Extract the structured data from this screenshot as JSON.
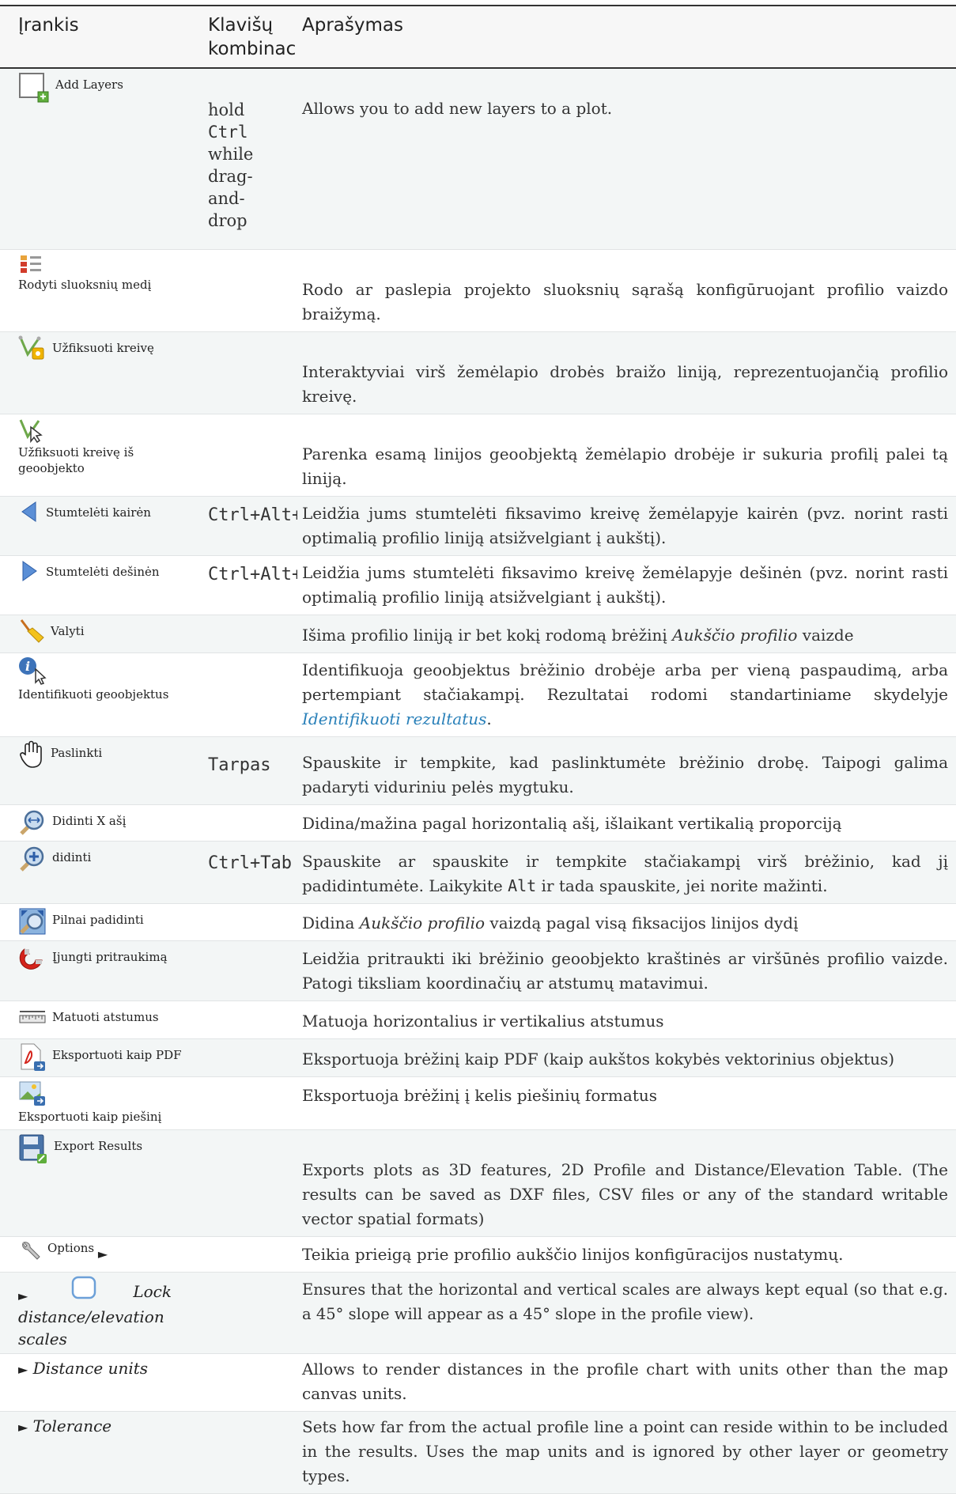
{
  "header": {
    "col_tool": "Įrankis",
    "col_keys": "Klavišų kombinacija",
    "col_desc": "Aprašymas"
  },
  "rows": [
    {
      "tool": "Add Layers",
      "icon": "add-layers-icon",
      "keys_hold": "hold",
      "keys_ctrl": "Ctrl",
      "keys_rest": "while drag-and-drop",
      "desc": "Allows you to add new layers to a plot."
    },
    {
      "tool": "Rodyti sluoksnių medį",
      "icon": "layer-tree-icon",
      "desc": "Rodo ar paslepia projekto sluoksnių sąrašą konfigūruojant profilio vaizdo braižymą."
    },
    {
      "tool": "Užfiksuoti kreivę",
      "icon": "capture-curve-icon",
      "desc": "Interaktyviai virš žemėlapio drobės braižo liniją, reprezentuojančią profilio kreivę."
    },
    {
      "tool": "Užfiksuoti kreivę iš geoobjekto",
      "icon": "capture-curve-from-feature-icon",
      "desc": "Parenka esamą linijos geoobjektą žemėlapio drobėje ir sukuria profilį palei tą liniją."
    },
    {
      "tool": "Stumtelėti kairėn",
      "icon": "nudge-left-icon",
      "keys": "Ctrl+Alt+Left",
      "desc": "Leidžia jums stumtelėti fiksavimo kreivę žemėlapyje kairėn (pvz. norint rasti optimalią profilio liniją atsižvelgiant į aukštį)."
    },
    {
      "tool": "Stumtelėti dešinėn",
      "icon": "nudge-right-icon",
      "keys": "Ctrl+Alt+Right",
      "desc": "Leidžia jums stumtelėti fiksavimo kreivę žemėlapyje dešinėn (pvz. norint rasti optimalią profilio liniją atsižvelgiant į aukštį)."
    },
    {
      "tool": "Valyti",
      "icon": "clear-broom-icon",
      "desc_a": "Išima profilio liniją ir bet kokį rodomą brėžinį ",
      "desc_em": "Aukščio profilio",
      "desc_b": " vaizde"
    },
    {
      "tool": "Identifikuoti geoobjektus",
      "icon": "identify-icon",
      "desc_a": "Identifikuoja geoobjektus brėžinio drobėje arba per vieną paspaudimą, arba pertempiant stačiakampį. Rezultatai rodomi standartiniame skydelyje ",
      "desc_link": "Identifikuoti rezultatus",
      "desc_b": "."
    },
    {
      "tool": "Paslinkti",
      "icon": "pan-hand-icon",
      "keys": "Tarpas",
      "desc": "Spauskite ir tempkite, kad paslinktumėte brėžinio drobę. Taipogi galima padaryti viduriniu pelės mygtuku."
    },
    {
      "tool": "Didinti X ašį",
      "icon": "zoom-x-axis-icon",
      "desc": "Didina/mažina pagal horizontalią ašį, išlaikant vertikalią proporciją"
    },
    {
      "tool": "didinti",
      "icon": "zoom-in-icon",
      "keys": "Ctrl+Tab",
      "desc_a": "Spauskite ar spauskite ir tempkite stačiakampį virš brėžinio, kad jį padidintumėte. Laikykite ",
      "desc_mono": "Alt",
      "desc_b": " ir tada spauskite, jei norite mažinti."
    },
    {
      "tool": "Pilnai padidinti",
      "icon": "zoom-full-icon",
      "desc_a": "Didina ",
      "desc_em": "Aukščio profilio",
      "desc_b": " vaizdą pagal visą fiksacijos linijos dydį"
    },
    {
      "tool": "Įjungti pritraukimą",
      "icon": "snapping-magnet-icon",
      "desc": "Leidžia pritraukti iki brėžinio geoobjekto kraštinės ar viršūnės profilio vaizde. Patogi tiksliam koordinačių ar atstumų matavimui."
    },
    {
      "tool": "Matuoti atstumus",
      "icon": "measure-ruler-icon",
      "desc": "Matuoja horizontalius ir vertikalius atstumus"
    },
    {
      "tool": "Eksportuoti kaip PDF",
      "icon": "export-pdf-icon",
      "desc": "Eksportuoja brėžinį kaip PDF (kaip aukštos kokybės vektorinius objektus)"
    },
    {
      "tool": "Eksportuoti kaip piešinį",
      "icon": "export-image-icon",
      "desc": "Eksportuoja brėžinį į kelis piešinių formatus"
    },
    {
      "tool": "Export Results",
      "icon": "export-results-icon",
      "desc": "Exports plots as 3D features, 2D Profile and Distance/Elevation Table. (The results can be saved as DXF files, CSV files or any of the standard writable vector spatial formats)"
    },
    {
      "tool": "Options",
      "icon": "options-wrench-icon",
      "arrow": "►",
      "desc": "Teikia prieigą prie profilio aukščio linijos konfigūracijos nustatymų."
    },
    {
      "arrow": "►",
      "icon": "checkbox-icon",
      "tool_a": "Lock",
      "tool_b": "distance/elevation scales",
      "desc": "Ensures that the horizontal and vertical scales are always kept equal (so that e.g. a 45° slope will appear as a 45° slope in the profile view)."
    },
    {
      "arrow": "►",
      "tool": "Distance units",
      "desc": "Allows to render distances in the profile chart with units other than the map canvas units."
    },
    {
      "arrow": "►",
      "tool": "Tolerance",
      "desc": "Sets how far from the actual profile line a point can reside within to be included in the results. Uses the map units and is ignored by other layer or geometry types."
    }
  ]
}
